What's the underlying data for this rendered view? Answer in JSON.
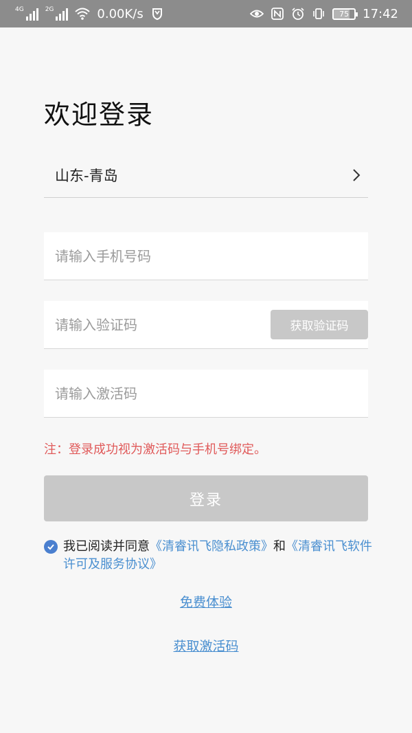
{
  "status_bar": {
    "net1": "4G",
    "net2": "2G",
    "speed": "0.00K/s",
    "battery": "75",
    "battery_level": 0.75,
    "time": "17:42"
  },
  "page_title": "欢迎登录",
  "region": {
    "value": "山东-青岛"
  },
  "phone_field": {
    "placeholder": "请输入手机号码",
    "value": ""
  },
  "code_field": {
    "placeholder": "请输入验证码",
    "value": "",
    "button_label": "获取验证码"
  },
  "activation_field": {
    "placeholder": "请输入激活码",
    "value": ""
  },
  "note": "注：登录成功视为激活码与手机号绑定。",
  "login_button": "登录",
  "agreement": {
    "checked": true,
    "prefix": "我已阅读并同意",
    "privacy_link": "《清睿讯飞隐私政策》",
    "and": "和",
    "license_link": "《清睿讯飞软件许可及服务协议》"
  },
  "free_trial_link": "免费体验",
  "get_activation_link": "获取激活码",
  "colors": {
    "accent": "#4a8fd0",
    "warning": "#e05a5a",
    "disabled": "#c8c8c8"
  }
}
